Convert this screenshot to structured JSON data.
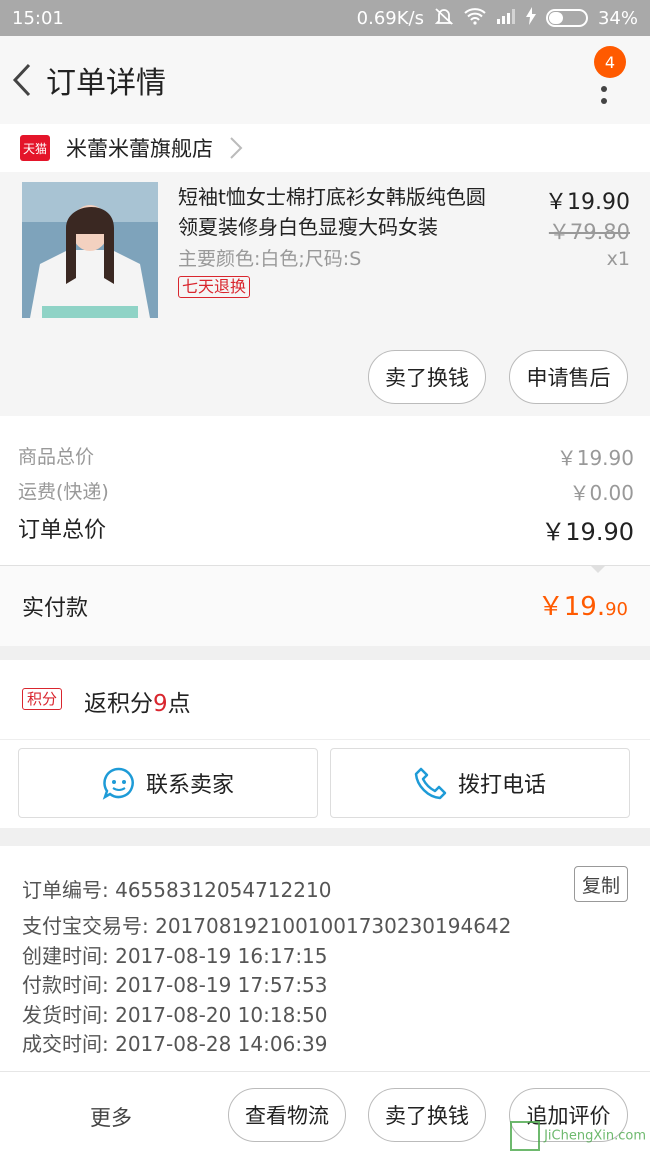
{
  "status_bar": {
    "time": "15:01",
    "speed": "0.69K/s",
    "battery": "34%"
  },
  "nav": {
    "title": "订单详情",
    "badge": "4"
  },
  "shop": {
    "icon_text": "天猫",
    "name": "米蕾米蕾旗舰店"
  },
  "product": {
    "title": "短袖t恤女士棉打底衫女韩版纯色圆领夏装修身白色显瘦大码女装",
    "sku": "主要颜色:白色;尺码:S",
    "tag": "七天退换",
    "price": "￥19.90",
    "original_price": "￥79.80",
    "quantity": "x1",
    "actions": [
      "卖了换钱",
      "申请售后"
    ]
  },
  "summary": {
    "goods_label": "商品总价",
    "goods_value": "￥19.90",
    "shipping_label": "运费(快递)",
    "shipping_value": "￥0.00",
    "total_label": "订单总价",
    "total_value": "￥19.90"
  },
  "paid": {
    "label": "实付款",
    "currency": "￥",
    "int": "19.",
    "dec": "90"
  },
  "points": {
    "tag": "积分",
    "prefix": "返积分",
    "num": "9",
    "suffix": "点"
  },
  "contact": {
    "seller": "联系卖家",
    "call": "拨打电话"
  },
  "info": {
    "order_no": "订单编号: 46558312054712210",
    "alipay_no": "支付宝交易号: 2017081921001001730230194642",
    "created": "创建时间: 2017-08-19 16:17:15",
    "paid": "付款时间: 2017-08-19 17:57:53",
    "shipped": "发货时间: 2017-08-20 10:18:50",
    "completed": "成交时间: 2017-08-28 14:06:39",
    "copy": "复制"
  },
  "footer": {
    "more": "更多",
    "logistics": "查看物流",
    "sell": "卖了换钱",
    "review": "追加评价"
  },
  "watermark": "JiChengXin.com",
  "colors": {
    "accent": "#ff5a00",
    "tmall": "#e4152a",
    "tag_red": "#d9262e",
    "contact_blue": "#1e9bd7"
  }
}
